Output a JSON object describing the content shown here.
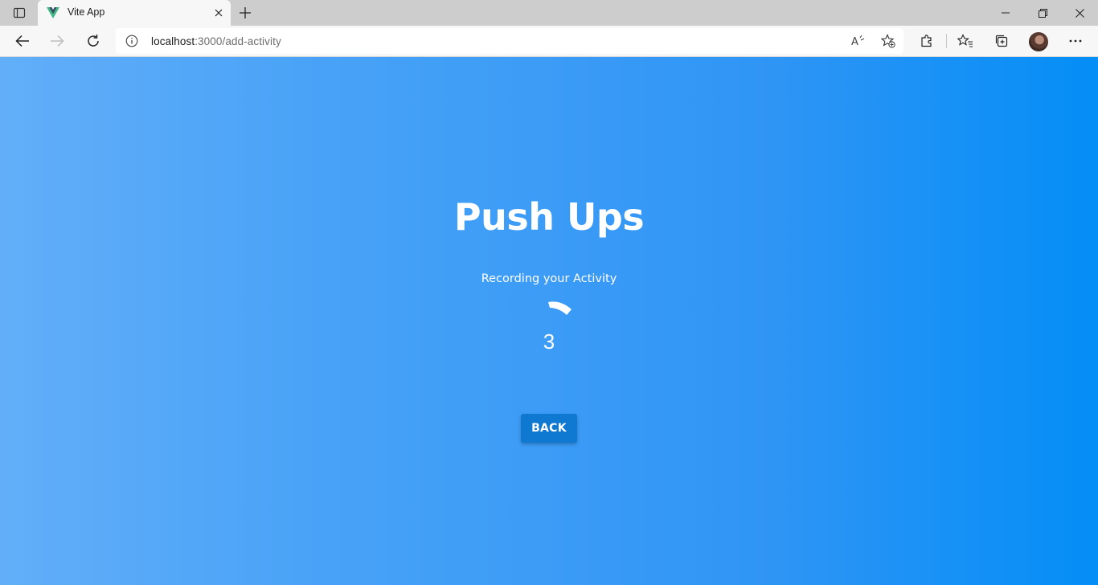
{
  "browser": {
    "tab": {
      "title": "Vite App"
    },
    "address": {
      "host": "localhost",
      "path": ":3000/add-activity"
    }
  },
  "icons": {
    "tab_actions": "tab-actions-icon",
    "favicon": "vue-logo-icon",
    "tab_close": "close-icon",
    "new_tab": "plus-icon",
    "minimize": "minimize-icon",
    "restore": "restore-icon",
    "close_window": "close-icon",
    "back": "arrow-left-icon",
    "forward": "arrow-right-icon",
    "refresh": "refresh-icon",
    "site_info": "info-icon",
    "read_aloud": "read-aloud-icon",
    "add_favorite": "star-plus-icon",
    "extensions": "puzzle-icon",
    "favorites": "favorites-icon",
    "collections": "collections-icon",
    "profile": "avatar",
    "menu": "more-icon"
  },
  "page": {
    "heading": "Push Ups",
    "status": "Recording your Activity",
    "counter": "3",
    "back_button": "BACK"
  },
  "colors": {
    "background_start": "#62aef9",
    "background_end": "#048ef6",
    "button": "#0f79d1",
    "favicon_green": "#41b883",
    "favicon_dark": "#35495e"
  }
}
